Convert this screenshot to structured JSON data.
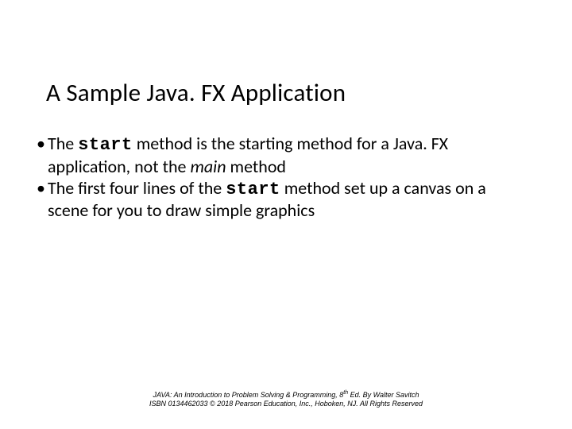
{
  "title": "A Sample Java. FX Application",
  "bullets": [
    {
      "pre": "The ",
      "code1": "start",
      "mid1": " method is the starting method for a Java. FX application, not the ",
      "ital": "main",
      "post": " method"
    },
    {
      "pre": "The first four lines of the ",
      "code1": "start",
      "mid1": " method set up a canvas on a scene for you to draw simple graphics",
      "ital": "",
      "post": ""
    }
  ],
  "footer": {
    "line1a": "JAVA: An Introduction to Problem Solving & Programming, 8",
    "line1sup": "th",
    "line1b": " Ed. By Walter Savitch",
    "line2": "ISBN 0134462033 © 2018 Pearson Education, Inc., Hoboken, NJ. All Rights Reserved"
  }
}
